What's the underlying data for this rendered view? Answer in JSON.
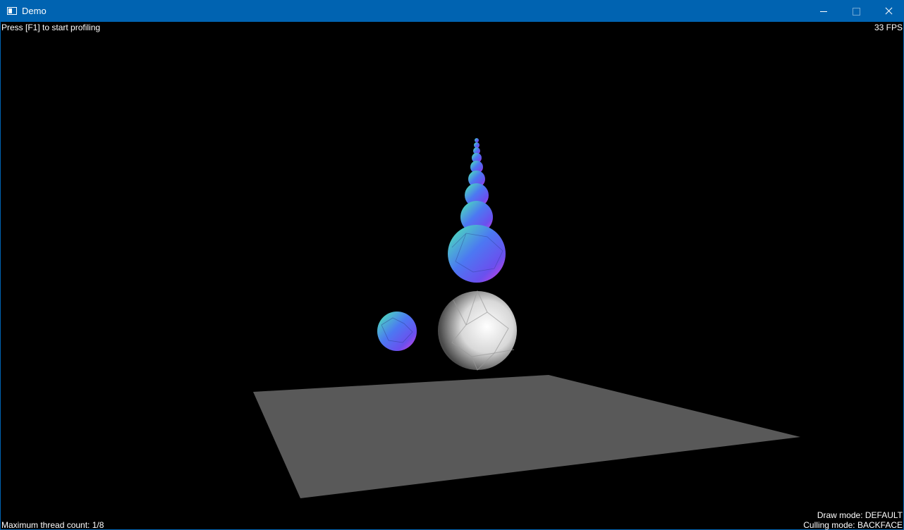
{
  "window": {
    "title": "Demo",
    "app_icon": "window-app-icon",
    "minimize_icon": "minimize-icon",
    "maximize_icon": "maximize-icon",
    "close_icon": "close-icon"
  },
  "hud": {
    "profiling_hint": "Press [F1] to start profiling",
    "fps": "33 FPS",
    "thread_count": "Maximum thread count: 1/8",
    "draw_mode": "Draw mode: DEFAULT",
    "culling_mode": "Culling mode: BACKFACE"
  },
  "scene": {
    "background": "#000000",
    "floor_color": "#595959",
    "white_sphere_color": "#dcdcdc",
    "rainbow_sphere_colors": [
      "#46e8c0",
      "#3c6cf0",
      "#b04cf0",
      "#e044e0"
    ]
  },
  "colors": {
    "titlebar": "#0063b1",
    "text": "#ffffff"
  }
}
